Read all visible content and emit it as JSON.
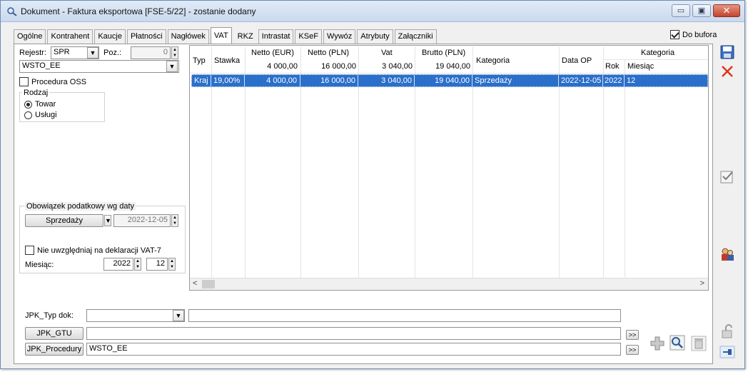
{
  "window": {
    "title": "Dokument - Faktura eksportowa [FSE-5/22]  - zostanie dodany",
    "minimize": "▭",
    "maximize": "▣",
    "close": "✕"
  },
  "tabs": [
    {
      "label": "Ogólne"
    },
    {
      "label": "Kontrahent"
    },
    {
      "label": "Kaucje"
    },
    {
      "label": "Płatności"
    },
    {
      "label": "Nagłówek"
    },
    {
      "label": "VAT",
      "active": true
    },
    {
      "label": "RKZ"
    },
    {
      "label": "Intrastat"
    },
    {
      "label": "KSeF"
    },
    {
      "label": "Wywóz"
    },
    {
      "label": "Atrybuty"
    },
    {
      "label": "Załączniki"
    }
  ],
  "do_bufora": {
    "label": "Do bufora",
    "checked": true
  },
  "left": {
    "rejestr_label": "Rejestr:",
    "rejestr_value": "SPR",
    "poz_label": "Poz.:",
    "poz_value": "0",
    "register_combo": "WSTO_EE",
    "procedura_oss": {
      "label": "Procedura OSS",
      "checked": false
    },
    "rodzaj": {
      "title": "Rodzaj",
      "options": [
        {
          "label": "Towar",
          "selected": true
        },
        {
          "label": "Usługi",
          "selected": false
        }
      ]
    },
    "obowiazek": {
      "title": "Obowiązek podatkowy wg daty",
      "button": "Sprzedaży",
      "date": "2022-12-05"
    },
    "nie_uwzgledniaj": {
      "label": "Nie uwzględniaj na deklaracji VAT-7",
      "checked": false
    },
    "miesiac_label": "Miesiąc:",
    "year": "2022",
    "month": "12"
  },
  "grid": {
    "headers": {
      "typ": "Typ",
      "stawka": "Stawka",
      "netto_eur": "Netto (EUR)",
      "netto_pln": "Netto (PLN)",
      "vat": "Vat",
      "brutto_pln": "Brutto (PLN)",
      "kategoria": "Kategoria",
      "data_op": "Data OP",
      "kategoria_group": "Kategoria",
      "rok": "Rok",
      "miesiac": "Miesiąc"
    },
    "totals": {
      "netto_eur": "4 000,00",
      "netto_pln": "16 000,00",
      "vat": "3 040,00",
      "brutto_pln": "19 040,00"
    },
    "rows": [
      {
        "typ": "Kraj",
        "stawka": "19,00%",
        "netto_eur": "4 000,00",
        "netto_pln": "16 000,00",
        "vat": "3 040,00",
        "brutto_pln": "19 040,00",
        "kategoria": "Sprzedaży",
        "data_op": "2022-12-05",
        "rok": "2022",
        "miesiac": "12"
      }
    ]
  },
  "jpk": {
    "typ_dok_label": "JPK_Typ dok:",
    "typ_dok_value": "",
    "gtu_button": "JPK_GTU",
    "gtu_value": "",
    "procedury_button": "JPK_Procedury",
    "procedury_value": "WSTO_EE",
    "more": ">>"
  },
  "icons": {
    "save": "save-icon",
    "delete": "close-red-icon",
    "check": "checkbox-icon",
    "people": "people-icon",
    "lock": "unlock-icon",
    "pin": "pin-icon",
    "add": "plus-icon",
    "search": "magnifier-icon",
    "trash": "trash-icon"
  }
}
